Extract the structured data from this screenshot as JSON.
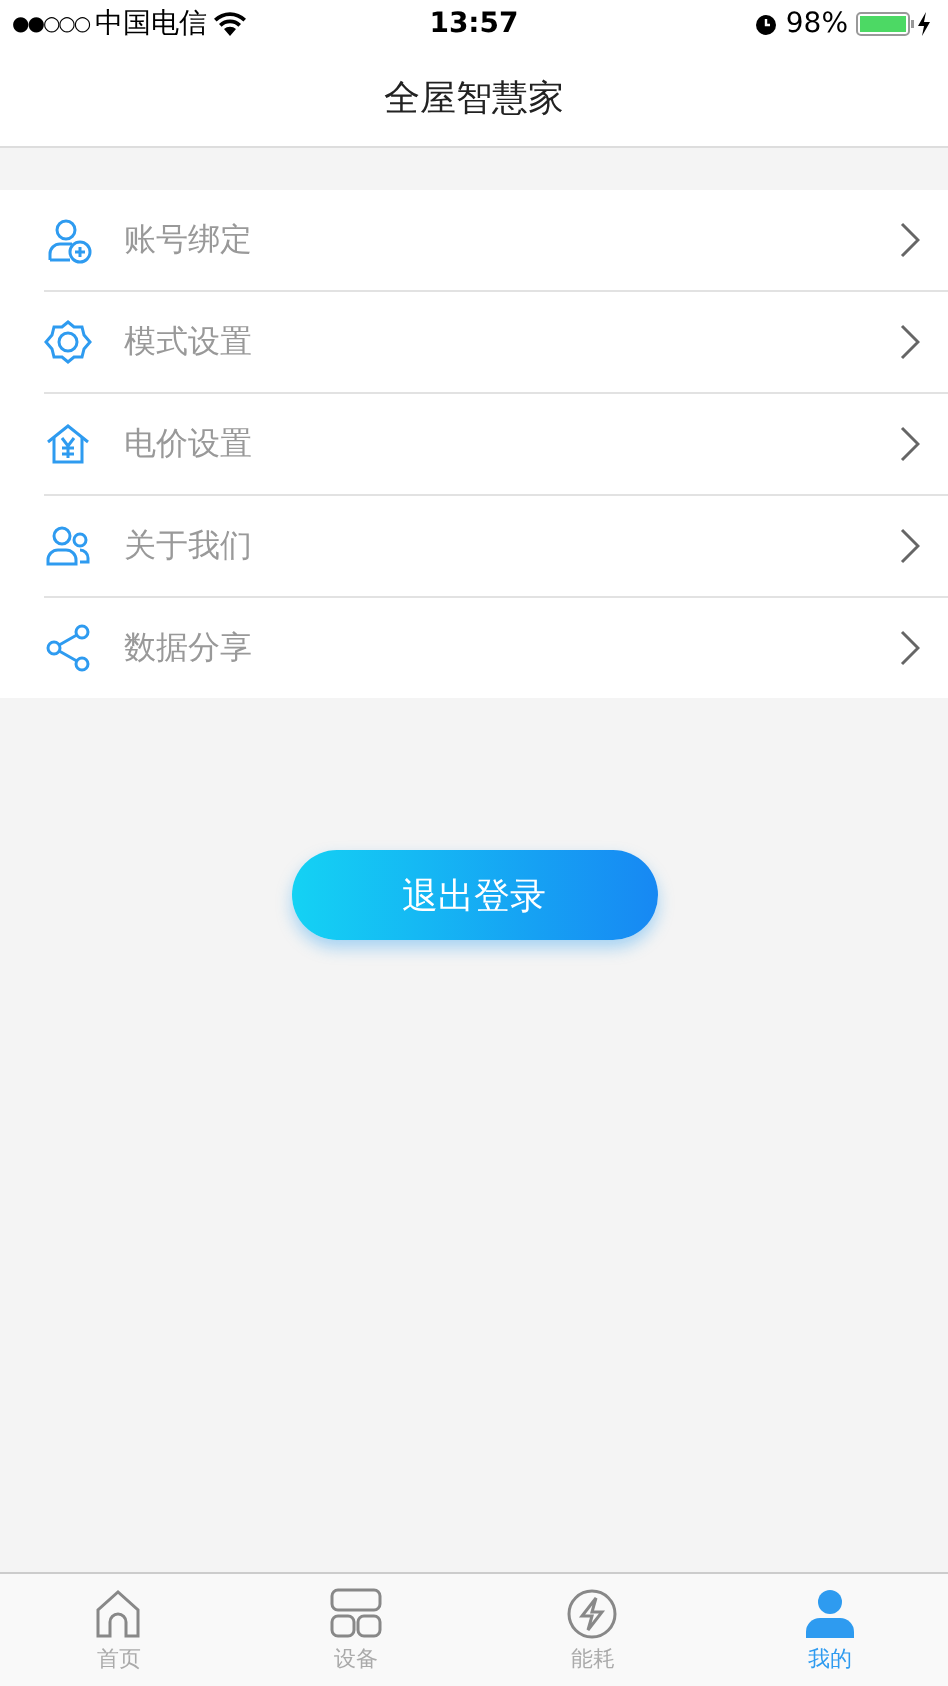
{
  "status_bar": {
    "signal": "●●○○○",
    "carrier": "中国电信",
    "time": "13:57",
    "battery": "98%"
  },
  "nav": {
    "title": "全屋智慧家"
  },
  "menu": [
    {
      "label": "账号绑定"
    },
    {
      "label": "模式设置"
    },
    {
      "label": "电价设置"
    },
    {
      "label": "关于我们"
    },
    {
      "label": "数据分享"
    }
  ],
  "logout_button": "退出登录",
  "tabs": [
    {
      "label": "首页",
      "selected": false
    },
    {
      "label": "设备",
      "selected": false
    },
    {
      "label": "能耗",
      "selected": false
    },
    {
      "label": "我的",
      "selected": true
    }
  ]
}
